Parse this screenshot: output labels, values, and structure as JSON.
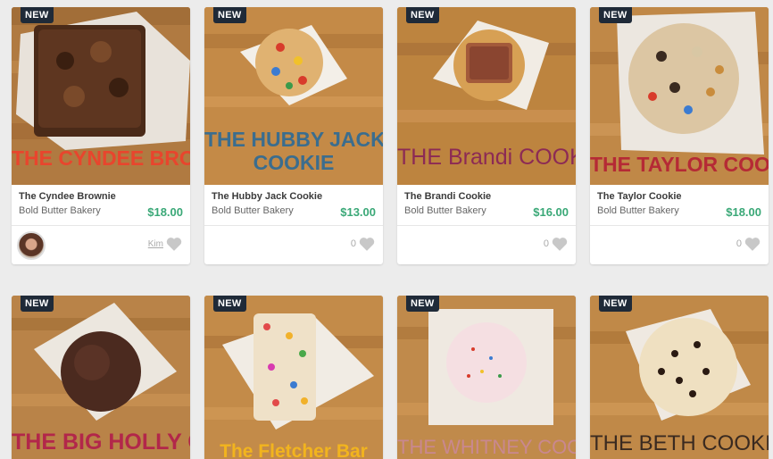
{
  "products": [
    {
      "badge": "NEW",
      "name": "The Cyndee Brownie",
      "shop": "Bold Butter Bakery",
      "price": "$18.00",
      "favorite_user": "Kim",
      "image_caption": "THE CYNDEE BROWNIE"
    },
    {
      "badge": "NEW",
      "name": "The Hubby Jack Cookie",
      "shop": "Bold Butter Bakery",
      "price": "$13.00",
      "favorites": "0",
      "image_caption": "THE HUBBY JACK\nCOOKIE"
    },
    {
      "badge": "NEW",
      "name": "The Brandi Cookie",
      "shop": "Bold Butter Bakery",
      "price": "$16.00",
      "favorites": "0",
      "image_caption": "THE Brandi COOKIE"
    },
    {
      "badge": "NEW",
      "name": "The Taylor Cookie",
      "shop": "Bold Butter Bakery",
      "price": "$18.00",
      "favorites": "0",
      "image_caption": "THE TAYLOR COOKIE"
    },
    {
      "badge": "NEW",
      "image_caption": "THE BIG HOLLY COOKIE"
    },
    {
      "badge": "NEW",
      "image_caption": "The Fletcher Bar"
    },
    {
      "badge": "NEW",
      "image_caption": "THE WHITNEY COOKIE"
    },
    {
      "badge": "NEW",
      "image_caption": "THE BETH COOKIE"
    }
  ],
  "colors": {
    "price": "#3aa877",
    "badge_bg": "#1f2a38",
    "heart": "#c8c8c8"
  },
  "icons": {
    "favorite": "heart-icon"
  }
}
